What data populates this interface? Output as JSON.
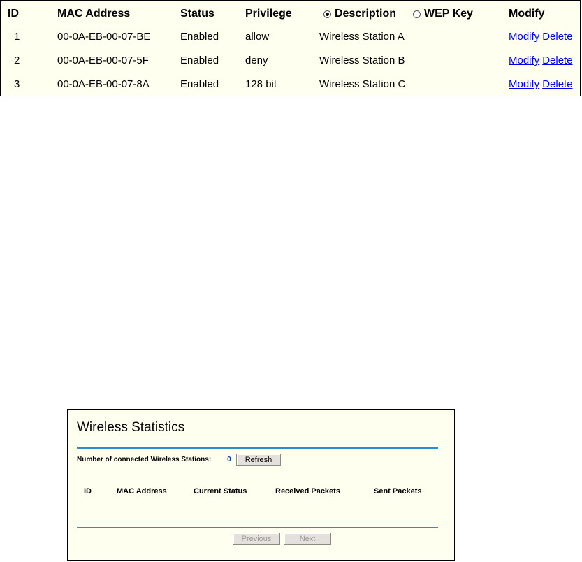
{
  "filter_table": {
    "headers": {
      "id": "ID",
      "mac": "MAC Address",
      "status": "Status",
      "privilege": "Privilege",
      "description": "Description",
      "wep_key": "WEP Key",
      "modify": "Modify"
    },
    "selected_column": "Description",
    "rows": [
      {
        "id": "1",
        "mac": "00-0A-EB-00-07-BE",
        "status": "Enabled",
        "privilege": "allow",
        "description": "Wireless Station A",
        "modify": "Modify",
        "delete": "Delete"
      },
      {
        "id": "2",
        "mac": "00-0A-EB-00-07-5F",
        "status": "Enabled",
        "privilege": "deny",
        "description": "Wireless Station B",
        "modify": "Modify",
        "delete": "Delete"
      },
      {
        "id": "3",
        "mac": "00-0A-EB-00-07-8A",
        "status": "Enabled",
        "privilege": "128 bit",
        "description": "Wireless Station C",
        "modify": "Modify",
        "delete": "Delete"
      }
    ]
  },
  "stats": {
    "title": "Wireless Statistics",
    "connected_label": "Number of connected Wireless Stations:",
    "connected_count": "0",
    "refresh_label": "Refresh",
    "headers": {
      "id": "ID",
      "mac": "MAC Address",
      "current_status": "Current Status",
      "received": "Received Packets",
      "sent": "Sent Packets"
    },
    "previous_label": "Previous",
    "next_label": "Next"
  },
  "colors": {
    "panel_bg": "#fffff0",
    "rule": "#2a8fc7",
    "link": "#0000ee"
  }
}
